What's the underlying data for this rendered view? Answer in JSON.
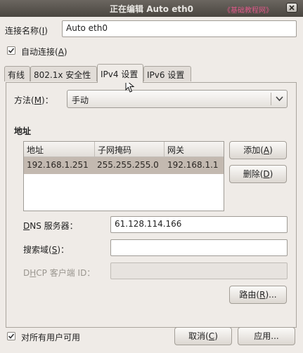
{
  "window": {
    "title": "正在编辑 Auto eth0",
    "watermark": "《基础教程网》"
  },
  "connection": {
    "name_label": "连接名称(",
    "name_label_key": "I",
    "name_label_end": ")",
    "name_value": "Auto eth0",
    "auto_connect_label": "自动连接(",
    "auto_connect_key": "A",
    "auto_connect_end": ")",
    "auto_connect_checked": true
  },
  "tabs": [
    {
      "label": "有线",
      "active": false
    },
    {
      "label": "802.1x 安全性",
      "active": false
    },
    {
      "label": "IPv4 设置",
      "active": true
    },
    {
      "label": "IPv6 设置",
      "active": false
    }
  ],
  "ipv4": {
    "method_label": "方法(",
    "method_key": "M",
    "method_end": ")：",
    "method_value": "手动",
    "address_section": "地址",
    "table": {
      "columns": [
        "地址",
        "子网掩码",
        "网关"
      ],
      "rows": [
        [
          "192.168.1.251",
          "255.255.255.0",
          "192.168.1.1"
        ]
      ]
    },
    "add_button": {
      "pre": "添加(",
      "key": "A",
      "post": ")"
    },
    "delete_button": {
      "pre": "删除(",
      "key": "D",
      "post": ")"
    },
    "dns_label": {
      "key": "D",
      "rest": "NS 服务器："
    },
    "dns_value": "61.128.114.166",
    "search_label": {
      "pre": "搜索域(",
      "key": "S",
      "post": ")："
    },
    "search_value": "",
    "dhcp_label": {
      "pre": "D",
      "key": "H",
      "rest": "CP 客户端 ID："
    },
    "dhcp_value": "",
    "routes_button": {
      "pre": "路由(",
      "key": "R",
      "post": ")..."
    }
  },
  "footer": {
    "all_users": {
      "pre": "对所有用户可用"
    },
    "all_users_checked": true,
    "cancel": {
      "pre": "取消(",
      "key": "C",
      "post": ")"
    },
    "apply": "应用..."
  },
  "colors": {
    "titlebar": "#4a4640",
    "body": "#efebe7",
    "selection": "#c3b9b0"
  }
}
